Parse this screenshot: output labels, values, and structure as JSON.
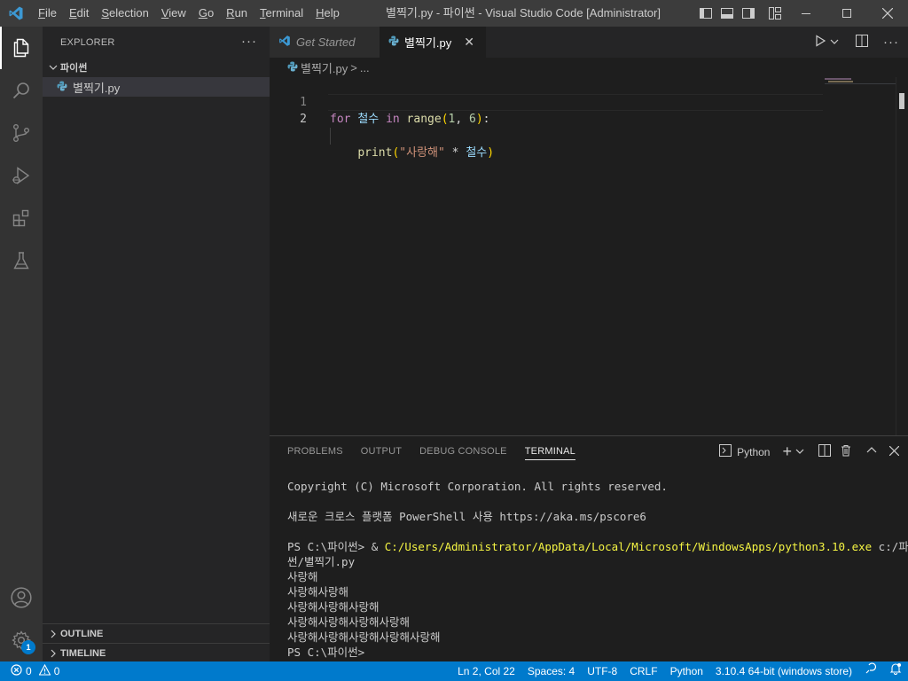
{
  "window": {
    "title": "별찍기.py - 파이썬 - Visual Studio Code [Administrator]"
  },
  "menu": {
    "items": [
      {
        "label": "File",
        "key": "F",
        "rest": "ile"
      },
      {
        "label": "Edit",
        "key": "E",
        "rest": "dit"
      },
      {
        "label": "Selection",
        "key": "S",
        "rest": "election"
      },
      {
        "label": "View",
        "key": "V",
        "rest": "iew"
      },
      {
        "label": "Go",
        "key": "G",
        "rest": "o"
      },
      {
        "label": "Run",
        "key": "R",
        "rest": "un"
      },
      {
        "label": "Terminal",
        "key": "T",
        "rest": "erminal"
      },
      {
        "label": "Help",
        "key": "H",
        "rest": "elp"
      }
    ]
  },
  "activity_bar": {
    "icons": [
      "explorer-icon",
      "search-icon",
      "source-control-icon",
      "run-debug-icon",
      "extensions-icon",
      "testing-icon"
    ],
    "bottom_icons": [
      "account-icon",
      "settings-gear-icon"
    ],
    "settings_badge": "1"
  },
  "sidebar": {
    "title": "EXPLORER",
    "more": "···",
    "folder": "파이썬",
    "file": "별찍기.py",
    "outline": "OUTLINE",
    "timeline": "TIMELINE"
  },
  "editor": {
    "tabs": [
      {
        "label": "Get Started",
        "active": false
      },
      {
        "label": "별찍기.py",
        "active": true
      }
    ],
    "breadcrumb": {
      "file": "별찍기.py",
      "sep": ">",
      "rest": "..."
    },
    "lines": [
      {
        "number": "1",
        "tokens": [
          {
            "t": "for",
            "c": "kw"
          },
          {
            "t": " ",
            "c": "op"
          },
          {
            "t": "철수",
            "c": "var"
          },
          {
            "t": " ",
            "c": "op"
          },
          {
            "t": "in",
            "c": "kw"
          },
          {
            "t": " ",
            "c": "op"
          },
          {
            "t": "range",
            "c": "fn"
          },
          {
            "t": "(",
            "c": "br1"
          },
          {
            "t": "1",
            "c": "num"
          },
          {
            "t": ", ",
            "c": "op"
          },
          {
            "t": "6",
            "c": "num"
          },
          {
            "t": ")",
            "c": "br1"
          },
          {
            "t": ":",
            "c": "op"
          }
        ]
      },
      {
        "number": "2",
        "tokens": [
          {
            "t": "    ",
            "c": "op"
          },
          {
            "t": "print",
            "c": "fn"
          },
          {
            "t": "(",
            "c": "br1"
          },
          {
            "t": "\"사랑해\"",
            "c": "str"
          },
          {
            "t": " * ",
            "c": "op"
          },
          {
            "t": "철수",
            "c": "var"
          },
          {
            "t": ")",
            "c": "br1"
          }
        ]
      }
    ]
  },
  "panel": {
    "tabs": [
      "PROBLEMS",
      "OUTPUT",
      "DEBUG CONSOLE",
      "TERMINAL"
    ],
    "active_tab": "TERMINAL",
    "terminal_name": "Python",
    "terminal": {
      "line1": "Copyright (C) Microsoft Corporation. All rights reserved.",
      "line2": "새로운 크로스 플랫폼 PowerShell 사용 https://aka.ms/pscore6",
      "prompt1": "PS C:\\파이썬> ",
      "cmd_amp": "& ",
      "cmd_path": "C:/Users/Administrator/AppData/Local/Microsoft/WindowsApps/python3.10.exe",
      "cmd_arg1": " c:/파이",
      "cmd_arg2": "썬/별찍기.py",
      "outputs": [
        "사랑해",
        "사랑해사랑해",
        "사랑해사랑해사랑해",
        "사랑해사랑해사랑해사랑해",
        "사랑해사랑해사랑해사랑해사랑해"
      ],
      "prompt2": "PS C:\\파이썬>"
    }
  },
  "status_bar": {
    "errors": "0",
    "warnings": "0",
    "position": "Ln 2, Col 22",
    "spaces": "Spaces: 4",
    "encoding": "UTF-8",
    "eol": "CRLF",
    "language": "Python",
    "interpreter": "3.10.4 64-bit (windows store)"
  },
  "colors": {
    "accent": "#007acc",
    "titlebar": "#3c3c3c",
    "activitybar": "#333333",
    "sidebar": "#252526",
    "editor": "#1e1e1e"
  }
}
